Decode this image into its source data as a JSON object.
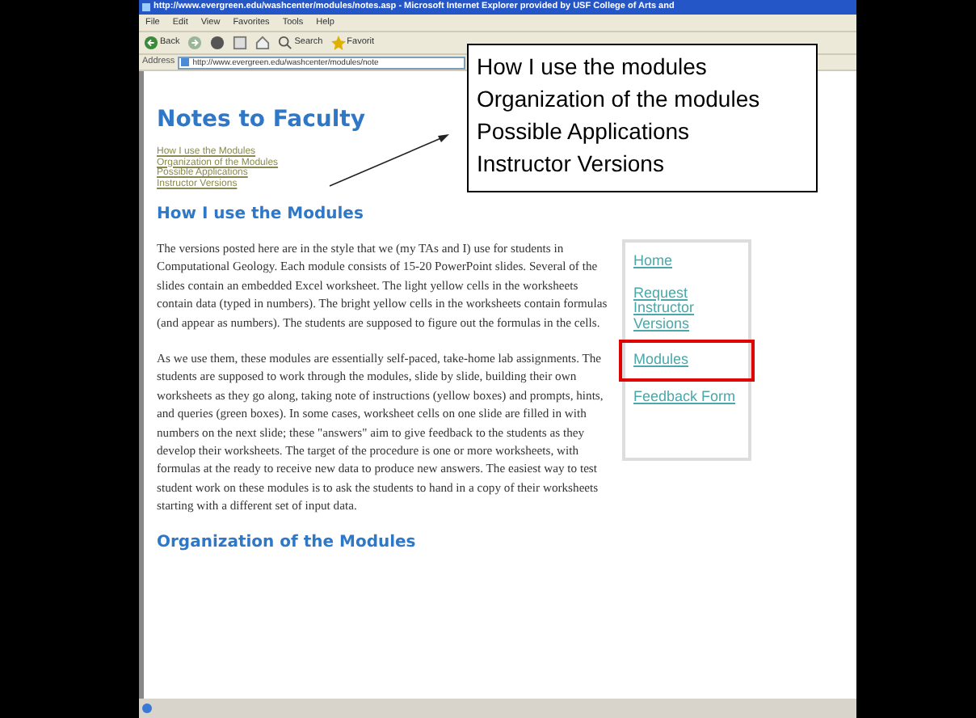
{
  "window": {
    "title": "http://www.evergreen.edu/washcenter/modules/notes.asp - Microsoft Internet Explorer provided by USF College of Arts and"
  },
  "menu": [
    "File",
    "Edit",
    "View",
    "Favorites",
    "Tools",
    "Help"
  ],
  "toolbar": [
    {
      "kind": "back",
      "label": "Back"
    },
    {
      "kind": "forward"
    },
    {
      "kind": "stop"
    },
    {
      "kind": "refresh"
    },
    {
      "kind": "home"
    },
    {
      "kind": "search",
      "label": "Search"
    },
    {
      "kind": "favorites",
      "label": "Favorit"
    }
  ],
  "address": {
    "label": "Address",
    "url": "http://www.evergreen.edu/washcenter/modules/note"
  },
  "page": {
    "title": "Notes to Faculty",
    "toc": [
      "How I use the Modules",
      "Organization of the Modules",
      "Possible Applications",
      "Instructor Versions"
    ],
    "sections": [
      {
        "heading": "How I use the Modules",
        "paragraphs": [
          "The versions posted here are in the style that we (my TAs and I) use for students in Computational Geology. Each module consists of 15-20 PowerPoint slides. Several of the slides contain an embedded Excel worksheet. The light yellow cells in the worksheets contain data (typed in numbers). The bright yellow cells in the worksheets contain formulas (and appear as numbers). The students are supposed to figure out the formulas in the cells.",
          "As we use them, these modules are essentially self-paced, take-home lab assignments. The students are supposed to work through the modules, slide by slide, building their own worksheets as they go along, taking note of instructions (yellow boxes) and prompts, hints, and queries (green boxes). In some cases, worksheet cells on one slide are filled in with numbers on the next slide; these \"answers\" aim to give feedback to the students as they develop their worksheets. The target of the procedure is one or more worksheets, with formulas at the ready to receive new data to produce new answers. The easiest way to test student work on these modules is to ask the students to hand in a copy of their worksheets starting with a different set of input data."
        ]
      },
      {
        "heading": "Organization of the Modules"
      }
    ],
    "sidebar": [
      {
        "label": "Home",
        "highlighted": false
      },
      {
        "label": "Request Instructor Versions",
        "highlighted": false
      },
      {
        "label": "Modules",
        "highlighted": true
      },
      {
        "label": "Feedback Form",
        "highlighted": false
      }
    ]
  },
  "callout": [
    "How I use the modules",
    "Organization of the modules",
    "Possible Applications",
    "Instructor Versions"
  ]
}
